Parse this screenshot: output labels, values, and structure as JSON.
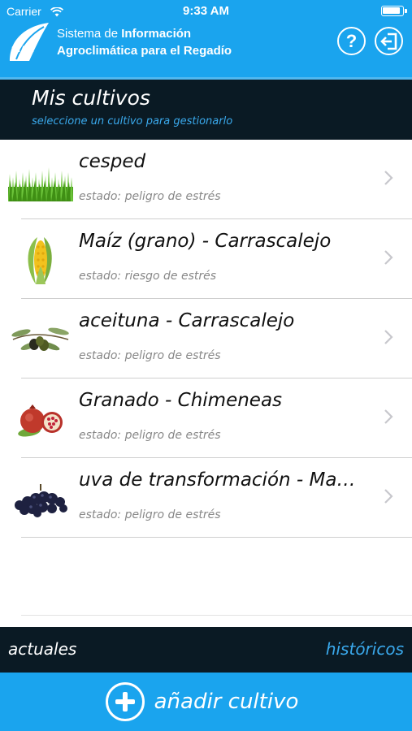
{
  "status_bar": {
    "carrier": "Carrier",
    "time": "9:33 AM"
  },
  "header": {
    "logo_text": "SiAR",
    "title_line1_regular": "Sistema de ",
    "title_line1_bold": "Información",
    "title_line2": "Agroclimática para el Regadío",
    "help_label": "?",
    "colors": {
      "primary": "#1aa4ee",
      "dark": "#0a1a24",
      "accent_text": "#3aa9ec"
    }
  },
  "section": {
    "title": "Mis cultivos",
    "subtitle": "seleccione un cultivo para gestionarlo"
  },
  "crops": [
    {
      "name": "cesped",
      "state": "estado: peligro de estrés",
      "icon": "grass-icon"
    },
    {
      "name": "Maíz (grano) - Carrascalejo",
      "state": "estado: riesgo de estrés",
      "icon": "corn-icon"
    },
    {
      "name": "aceituna - Carrascalejo",
      "state": "estado: peligro de estrés",
      "icon": "olive-icon"
    },
    {
      "name": "Granado - Chimeneas",
      "state": "estado: peligro de estrés",
      "icon": "pomegranate-icon"
    },
    {
      "name": "uva de transformación - Ma…",
      "state": "estado: peligro de estrés",
      "icon": "grapes-icon"
    }
  ],
  "tabs": {
    "current": "actuales",
    "history": "históricos"
  },
  "add_button": {
    "label": "añadir cultivo"
  }
}
